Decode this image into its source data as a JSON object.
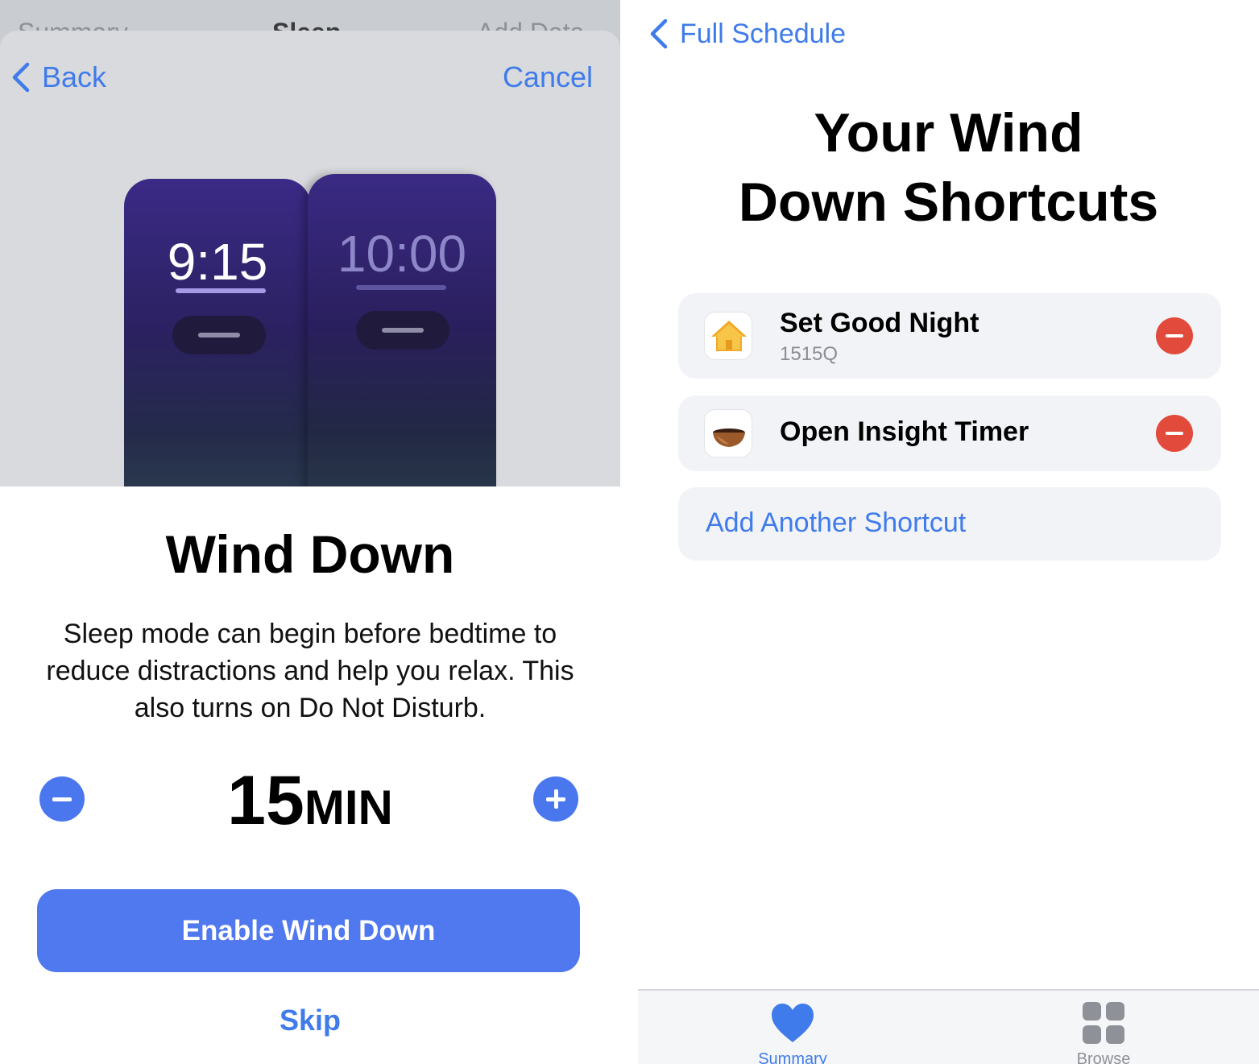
{
  "left": {
    "behind_nav": {
      "back_label": "Summary",
      "title": "Sleep",
      "action_label": "Add Data"
    },
    "sheet_nav": {
      "back_label": "Back",
      "cancel_label": "Cancel"
    },
    "preview": {
      "time_now": "9:15",
      "time_bed": "10:00"
    },
    "title": "Wind Down",
    "description": "Sleep mode can begin before bedtime to reduce distractions and help you relax. This also turns on Do Not Disturb.",
    "stepper": {
      "value": "15",
      "unit": "MIN"
    },
    "enable_label": "Enable Wind Down",
    "skip_label": "Skip"
  },
  "right": {
    "back_label": "Full Schedule",
    "title_line1": "Your Wind",
    "title_line2": "Down Shortcuts",
    "shortcuts": [
      {
        "name": "Set Good Night",
        "subtitle": "1515Q",
        "icon": "home-app-icon"
      },
      {
        "name": "Open Insight Timer",
        "subtitle": "",
        "icon": "singing-bowl-icon"
      }
    ],
    "add_label": "Add Another Shortcut",
    "tabbar": {
      "summary_label": "Summary",
      "browse_label": "Browse"
    }
  },
  "colors": {
    "accent": "#3f7bea",
    "button": "#5078ef",
    "delete": "#e24a3b"
  }
}
